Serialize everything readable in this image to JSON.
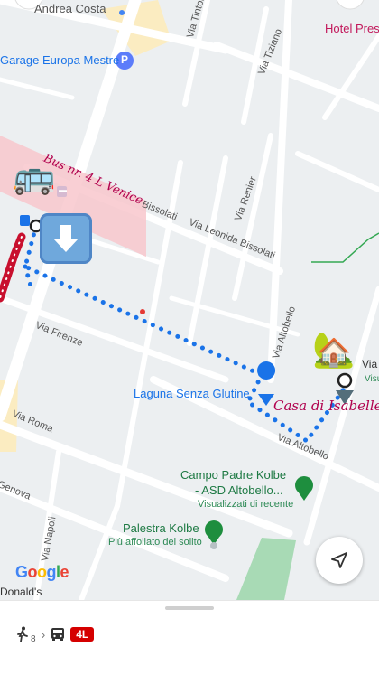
{
  "map": {
    "streets": {
      "andrea_costa": "Andrea Costa",
      "tintoretto": "Via Tintoretto",
      "tiziano": "Via Tiziano",
      "bissolati_short": "Bissolati",
      "renier": "Via Renier",
      "leonida_bissolati": "Via Leonida Bissolati",
      "altobello_vertical": "Via Altobello",
      "altobello_lower": "Via Altobello",
      "firenze": "Via Firenze",
      "roma": "Via Roma",
      "genova": "Genova",
      "napoli": "Via Napoli",
      "via_right": "Via I"
    },
    "places": {
      "hotel": "Hotel Pres",
      "garage": "Garage Europa Mestre",
      "laguna": "Laguna Senza Glutine",
      "campo_line1": "Campo Padre Kolbe",
      "campo_line2": "- ASD Altobello...",
      "campo_sub": "Visualizzati di recente",
      "palestra": "Palestra Kolbe",
      "palestra_sub": "Più affollato del solito",
      "mcdonalds": "Donald's",
      "visua": "Visua"
    },
    "annotations": {
      "bus_label": "Bus nr. 4 L Venice",
      "casa_label": "Casa di Isabelle"
    },
    "emoji": {
      "bus": "🚌",
      "house": "🏡",
      "down_arrow": "⬇️"
    },
    "brand": "Google"
  },
  "bottom_sheet": {
    "walk_minutes": "8",
    "separator": "›",
    "route_number": "4L"
  }
}
